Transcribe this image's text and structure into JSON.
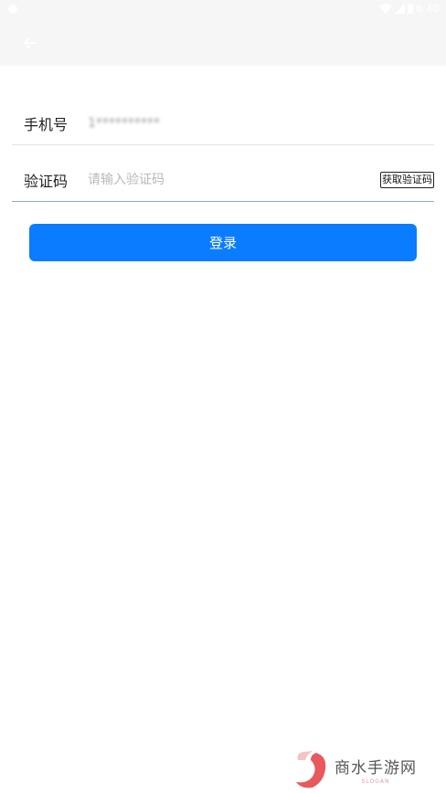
{
  "status_bar": {
    "time": "6:40",
    "icons": [
      "notification-icon",
      "wifi-icon",
      "signal-icon",
      "battery-icon"
    ]
  },
  "app_bar": {
    "back_icon": "back-arrow-icon"
  },
  "form": {
    "phone_label": "手机号",
    "phone_value": "1**********",
    "code_label": "验证码",
    "code_placeholder": "请输入验证码",
    "code_value": "",
    "get_code_label": "获取验证码",
    "login_label": "登录"
  },
  "watermark": {
    "name": "商水手游网",
    "slogan": "SLOGAN"
  },
  "colors": {
    "primary": "#0a7cff",
    "app_bar_bg": "#f6f6f6",
    "focused_underline": "#8aa9d4",
    "divider": "#e3e3e3",
    "label_text": "#222222",
    "placeholder": "#b9b9b9",
    "watermark_accent": "#e8585d"
  }
}
